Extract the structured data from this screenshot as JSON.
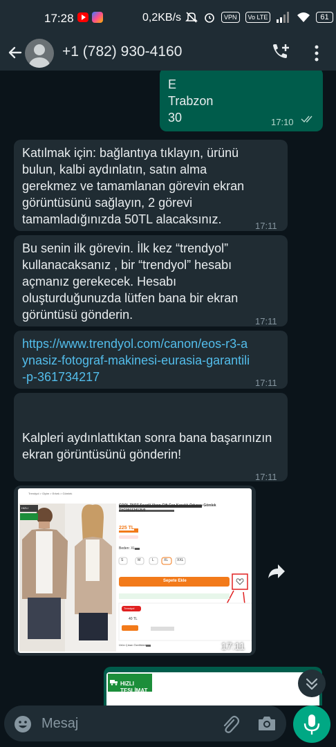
{
  "status_bar": {
    "time": "17:28",
    "network_speed": "0,2KB/s",
    "vpn_label": "VPN",
    "volte_label": "Vo LTE",
    "battery": "61"
  },
  "header": {
    "contact_name": "+1 (782) 930-4160"
  },
  "messages": [
    {
      "direction": "out",
      "text": "E\nTrabzon\n30",
      "time": "17:10"
    },
    {
      "direction": "in",
      "text": "Katılmak için: bağlantıya tıklayın, ürünü bulun, kalbi aydınlatın, satın alma gerekmez ve tamamlanan görevin ekran görüntüsünü sağlayın, 2 görevi tamamladığınızda 50TL alacaksınız.",
      "time": "17:11"
    },
    {
      "direction": "in",
      "text": "Bu senin ilk görevin. İlk kez “trendyol” kullanacaksanız , bir “trendyol” hesabı açmanız gerekecek. Hesabı oluşturduğunuzda lütfen bana bir ekran görüntüsü gönderin.",
      "time": "17:11"
    },
    {
      "direction": "in",
      "text": "https://www.trendyol.com/canon/eos-r3-aynasiz-fotograf-makinesi-eurasia-garantili-p-361734217",
      "time": "17:11"
    },
    {
      "direction": "in",
      "text": "Kalpleri aydınlattıktan sonra bana başarınızın ekran görüntüsünü gönderin!",
      "time": "17:11"
    },
    {
      "direction": "in",
      "type": "image",
      "time": "17:11"
    }
  ],
  "screenshot_image": {
    "breadcrumb": "Trendyol > Giyim > Erkek > Gömlek",
    "badge": "HIZLI",
    "product_title": "COOL TARZ Sevgili Vizon Çift Cep Kapaklı Oduncu Gömlek TYC00113412U0",
    "price": "225 TL",
    "size_label": "Beden: XL",
    "sizes": [
      "S",
      "M",
      "L",
      "XL",
      "XXL"
    ],
    "add_to_cart": "Sepete Ekle",
    "seller": "Trendyol",
    "seller_score": "40 TL",
    "footer_text": "Ürün Çıkarı Özellikleri"
  },
  "partial_message": {
    "badge_line1": "HIZLI",
    "badge_line2": "TESLİMAT"
  },
  "composer": {
    "placeholder": "Mesaj"
  },
  "colors": {
    "incoming_bubble": "#202c33",
    "outgoing_bubble": "#005c4b",
    "link": "#53bdeb",
    "accent": "#00a884",
    "trendyol_orange": "#f27a1a"
  }
}
